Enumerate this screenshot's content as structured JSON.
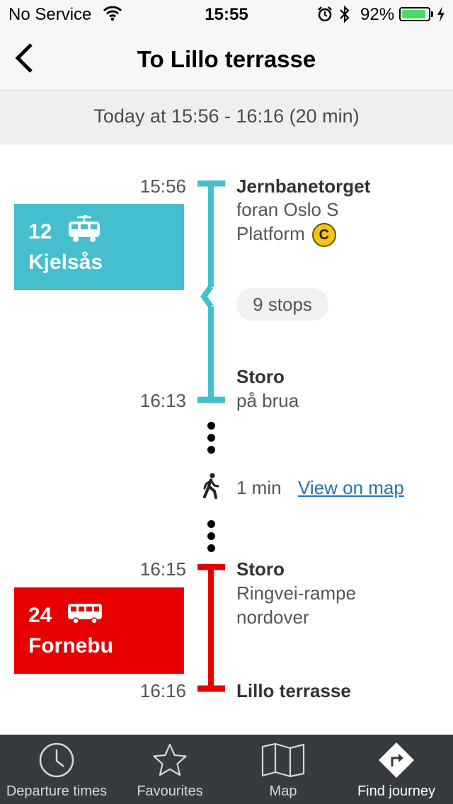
{
  "status_bar": {
    "carrier": "No Service",
    "time": "15:55",
    "battery_percent": "92%",
    "battery_level": 0.92
  },
  "nav": {
    "title": "To Lillo terrasse"
  },
  "summary": {
    "text": "Today at 15:56 - 16:16 (20 min)"
  },
  "legs": [
    {
      "line_number": "12",
      "vehicle_icon": "tram-icon",
      "destination": "Kjelsås",
      "color": "#45bfce",
      "departure_time": "15:56",
      "departure_stop": "Jernbanetorget",
      "departure_sub1": "foran Oslo S",
      "departure_sub2": "Platform",
      "platform": "C",
      "stops": "9 stops",
      "arrival_time": "16:13",
      "arrival_stop": "Storo",
      "arrival_sub": "på brua"
    },
    {
      "line_number": "24",
      "vehicle_icon": "bus-icon",
      "destination": "Fornebu",
      "color": "#e60000",
      "departure_time": "16:15",
      "departure_stop": "Storo",
      "departure_sub1": "Ringvei-rampe",
      "departure_sub2": "nordover",
      "arrival_time": "16:16",
      "arrival_stop": "Lillo terrasse"
    }
  ],
  "walk": {
    "duration": "1 min",
    "map_link": "View on map",
    "link_color": "#1f75b0"
  },
  "tabs": [
    {
      "label": "Departure times",
      "icon": "clock-icon"
    },
    {
      "label": "Favourites",
      "icon": "star-icon"
    },
    {
      "label": "Map",
      "icon": "map-icon"
    },
    {
      "label": "Find journey",
      "icon": "directions-icon",
      "active": true
    }
  ]
}
